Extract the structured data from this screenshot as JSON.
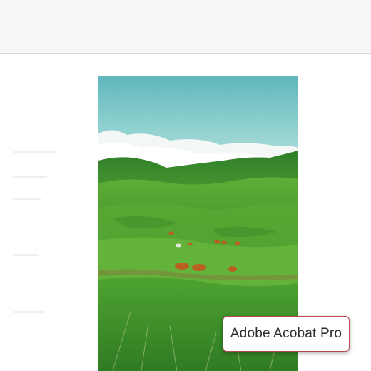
{
  "header": {
    "background": "#f6f6f6"
  },
  "image": {
    "alt": "Green hills with grazing cattle under a cloudy blue sky",
    "sky_color": "#7cc8c9",
    "grass_color": "#3f9a2c"
  },
  "badge": {
    "label": "Adobe Acobat Pro",
    "border_color": "#b84a55"
  }
}
